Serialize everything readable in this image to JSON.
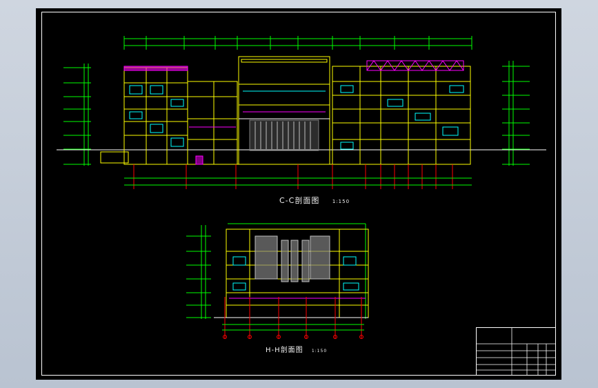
{
  "drawing": {
    "section_c": {
      "title": "C-C剖面图",
      "scale": "1:150"
    },
    "section_h": {
      "title": "H-H剖面图",
      "scale": "1:150"
    }
  },
  "colors": {
    "background": "#000000",
    "border": "#ffffff",
    "walls": "#ffff00",
    "dimensions": "#00ff00",
    "axes": "#ff0000",
    "accent_magenta": "#ff00ff",
    "accent_cyan": "#00ffff",
    "hatch": "#7f7f7f"
  }
}
